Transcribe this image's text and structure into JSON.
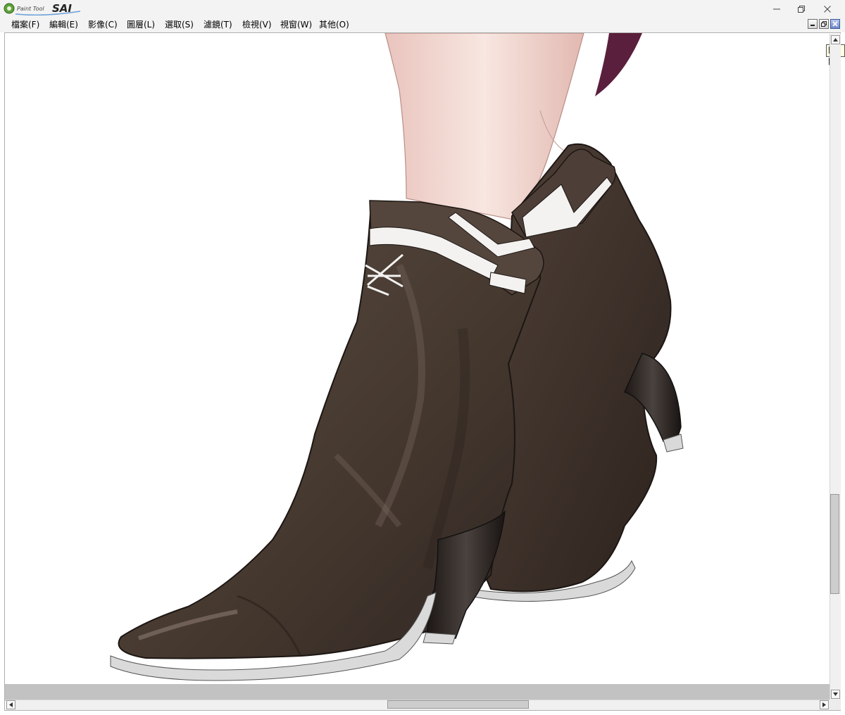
{
  "app": {
    "logo_text": "PaintTool SAI",
    "window_controls": {
      "minimize": "—",
      "restore": "❐",
      "close": "✕"
    }
  },
  "menu": {
    "items": [
      {
        "label": "檔案(F)",
        "mnemonic": "F"
      },
      {
        "label": "編輯(E)",
        "mnemonic": "E"
      },
      {
        "label": "影像(C)",
        "mnemonic": "C"
      },
      {
        "label": "圖層(L)",
        "mnemonic": "L"
      },
      {
        "label": "選取(S)",
        "mnemonic": "S"
      },
      {
        "label": "濾鏡(T)",
        "mnemonic": "T"
      },
      {
        "label": "檢視(V)",
        "mnemonic": "V"
      },
      {
        "label": "視窗(W)",
        "mnemonic": "W"
      },
      {
        "label": "其他(O)",
        "mnemonic": "O"
      }
    ]
  },
  "document_controls": {
    "minimize_icon": "mdi-minimize-icon",
    "restore_icon": "mdi-restore-icon",
    "close_icon": "mdi-close-icon",
    "close_tooltip": "關閉"
  },
  "canvas": {
    "subject": "brown-high-heel-ankle-boots-illustration",
    "colors": {
      "boot": "#4b3f38",
      "boot_dark": "#2f2622",
      "trim": "#f3f2f1",
      "skin": "#f4dcd6",
      "accent": "#5a1f3d",
      "sole": "#d9d9d9"
    }
  },
  "scrollbars": {
    "vertical": {
      "position_fraction": 0.75,
      "visible_fraction": 0.15
    },
    "horizontal": {
      "position_fraction": 0.56,
      "visible_fraction": 0.17
    }
  }
}
